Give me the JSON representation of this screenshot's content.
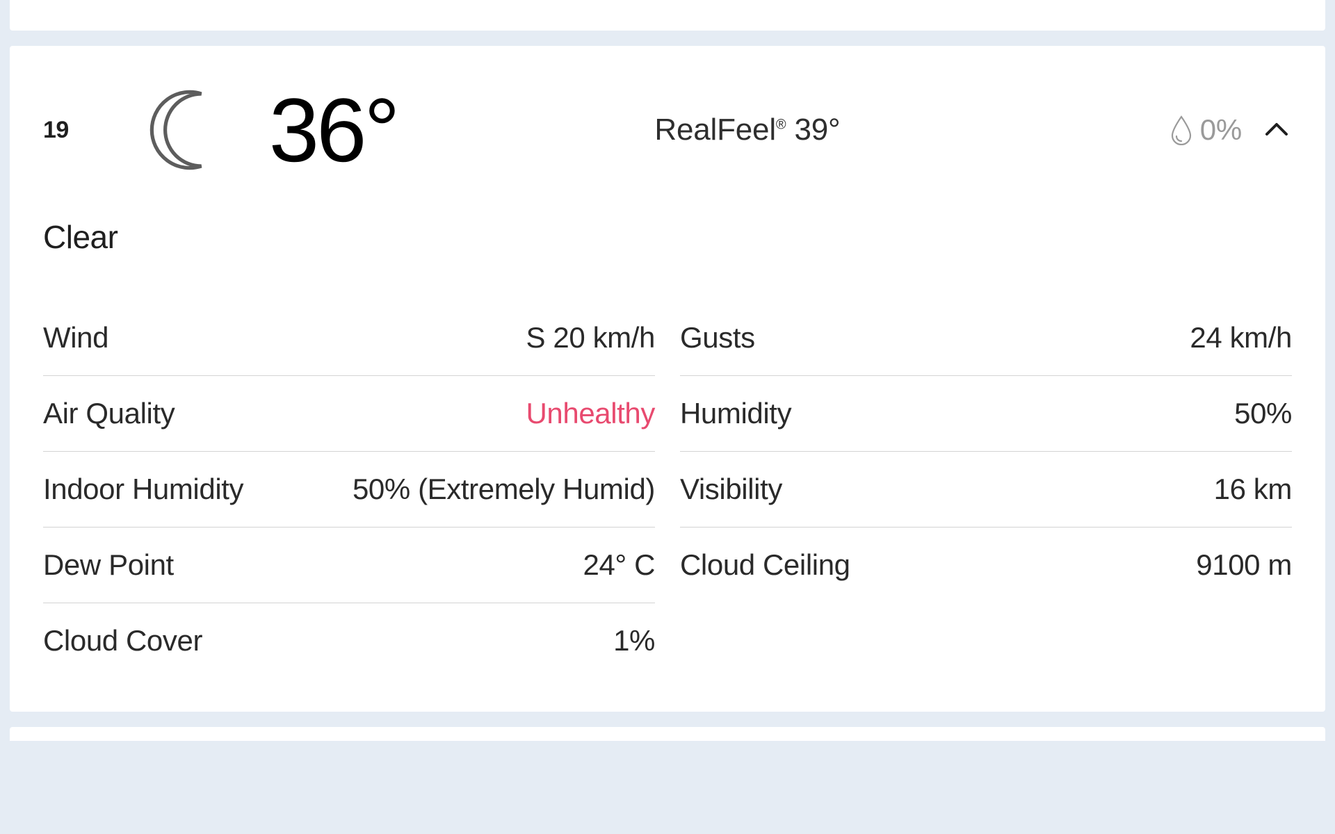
{
  "colors": {
    "unhealthy": "#e84a6f",
    "muted": "#9a9a9a"
  },
  "card": {
    "hour": "19",
    "temperature": "36°",
    "realfeel_label": "RealFeel",
    "realfeel_mark": "®",
    "realfeel_value": " 39°",
    "precip_pct": "0%",
    "condition": "Clear",
    "details_left": [
      {
        "label": "Wind",
        "value": "S 20 km/h"
      },
      {
        "label": "Air Quality",
        "value": "Unhealthy",
        "status": "unhealthy"
      },
      {
        "label": "Indoor Humidity",
        "value": "50% (Extremely Humid)"
      },
      {
        "label": "Dew Point",
        "value": "24° C"
      },
      {
        "label": "Cloud Cover",
        "value": "1%"
      }
    ],
    "details_right": [
      {
        "label": "Gusts",
        "value": "24 km/h"
      },
      {
        "label": "Humidity",
        "value": "50%"
      },
      {
        "label": "Visibility",
        "value": "16 km"
      },
      {
        "label": "Cloud Ceiling",
        "value": "9100 m"
      }
    ]
  }
}
